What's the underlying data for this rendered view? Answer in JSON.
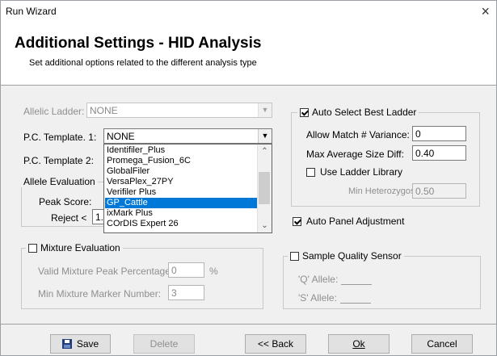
{
  "window": {
    "title": "Run Wizard",
    "close_glyph": "×"
  },
  "header": {
    "title": "Additional Settings - HID Analysis",
    "subtitle": "Set additional options related to the different analysis type"
  },
  "allelic_ladder": {
    "label": "Allelic Ladder:",
    "value": "NONE"
  },
  "pc_template_1": {
    "label": "P.C. Template. 1:",
    "value": "NONE"
  },
  "pc_template_2": {
    "label": "P.C. Template 2:"
  },
  "template_options": [
    "Identifiler_Plus",
    "Promega_Fusion_6C",
    "GlobalFiler",
    "VersaPlex_27PY",
    "Verifiler Plus",
    "GP_Cattle",
    "ixMark Plus",
    "COrDIS Expert 26"
  ],
  "selected_option": "GP_Cattle",
  "allele_evaluation": {
    "title": "Allele Evaluation",
    "peak_score_label": "Peak Score:",
    "reject_label": "Reject <",
    "reject_value": "1."
  },
  "auto_select": {
    "label": "Auto Select Best Ladder",
    "checked": true
  },
  "allow_match": {
    "label": "Allow Match # Variance:",
    "value": "0"
  },
  "max_avg_size": {
    "label": "Max Average Size Diff:",
    "value": "0.40"
  },
  "use_ladder_library": {
    "label": "Use Ladder Library",
    "checked": false
  },
  "min_heterozygosity": {
    "label": "Min Heterozygosity:",
    "value": "0.50"
  },
  "auto_panel": {
    "label": "Auto Panel Adjustment",
    "checked": true
  },
  "mixture": {
    "title": "Mixture Evaluation",
    "checked": false,
    "valid_label": "Valid Mixture Peak Percentage:",
    "valid_value": "0",
    "valid_unit": "%",
    "min_marker_label": "Min Mixture Marker Number:",
    "min_marker_value": "3"
  },
  "sample_quality": {
    "title": "Sample Quality Sensor",
    "checked": false,
    "q_label": "'Q' Allele:",
    "s_label": "'S' Allele:"
  },
  "buttons": {
    "save": "Save",
    "delete": "Delete",
    "back": "<< Back",
    "ok": "Ok",
    "cancel": "Cancel"
  }
}
